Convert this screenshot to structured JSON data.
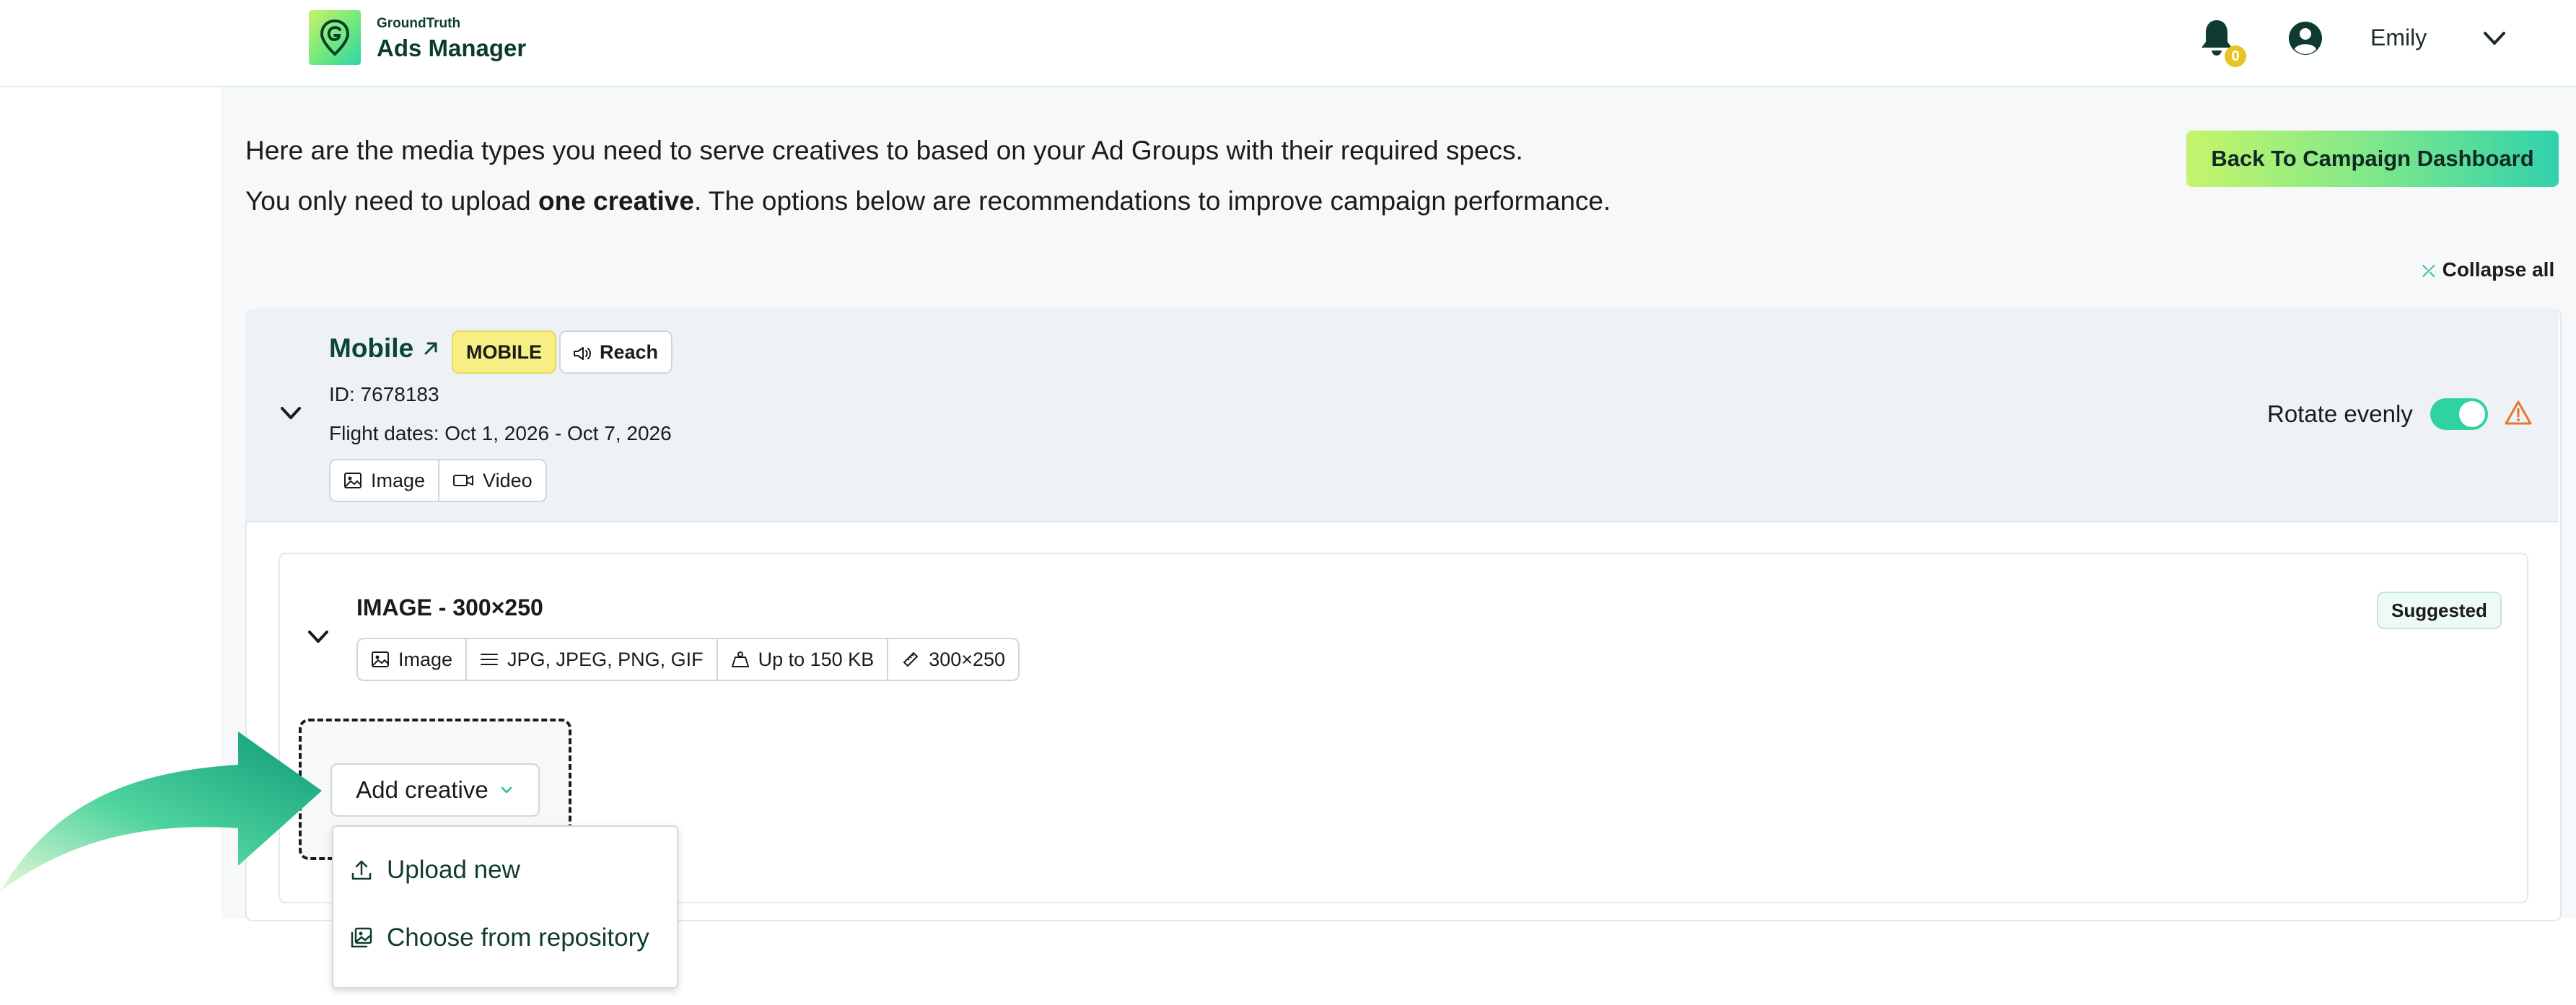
{
  "header": {
    "brand_small": "GroundTruth",
    "brand_big": "Ads Manager",
    "notification_count": "0",
    "user_name": "Emily"
  },
  "intro": {
    "line1": "Here are the media types you need to serve creatives to based on your Ad Groups with their required specs.",
    "line2_prefix": "You only need to upload ",
    "line2_bold": "one creative",
    "line2_suffix": ". The options below are recommendations to improve campaign performance."
  },
  "actions": {
    "back_button": "Back To Campaign Dashboard",
    "collapse_all": "Collapse all"
  },
  "ad_group": {
    "title": "Mobile",
    "type_tag": "MOBILE",
    "goal_tag": "Reach",
    "id": "ID: 7678183",
    "flight_dates": "Flight dates: Oct 1, 2026 - Oct 7, 2026",
    "media_types": [
      "Image",
      "Video"
    ],
    "rotate_label": "Rotate evenly",
    "rotate_enabled": true
  },
  "creative_spec": {
    "title": "IMAGE - 300×250",
    "badge": "Suggested",
    "specs": [
      "Image",
      "JPG, JPEG, PNG, GIF",
      "Up to 150 KB",
      "300×250"
    ],
    "add_button": "Add creative",
    "menu": [
      "Upload new",
      "Choose from repository"
    ]
  },
  "colors": {
    "brand_dark": "#0b3d2c",
    "accent": "#2ed3a1",
    "mobile_tag": "#f7ef84",
    "warning": "#e8762c"
  }
}
